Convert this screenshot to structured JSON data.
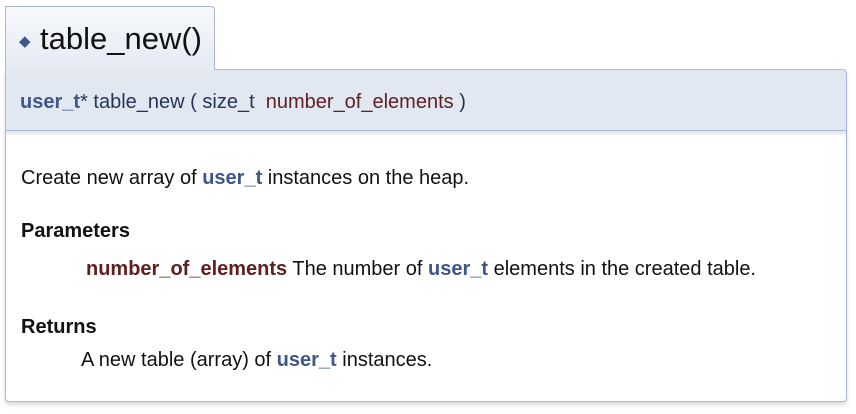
{
  "header": {
    "marker": "◆",
    "title": "table_new()"
  },
  "prototype": {
    "return_type": "user_t",
    "pointer": "*",
    "function_name": "table_new",
    "open_paren": "(",
    "param_type": "size_t",
    "param_name": "number_of_elements",
    "close_paren": ")"
  },
  "description": {
    "brief_before": "Create new array of",
    "brief_link": "user_t",
    "brief_after": "instances on the heap."
  },
  "parameters": {
    "heading": "Parameters",
    "items": [
      {
        "name": "number_of_elements",
        "desc_before": "The number of",
        "desc_link": "user_t",
        "desc_after": "elements in the created table."
      }
    ]
  },
  "returns": {
    "heading": "Returns",
    "text_before": "A new table (array) of",
    "link": "user_t",
    "text_after": "instances."
  },
  "colors": {
    "link": "#3d578c",
    "param_name": "#602020",
    "proto_background": "#e2e8f2",
    "border": "#a8b8d9"
  }
}
